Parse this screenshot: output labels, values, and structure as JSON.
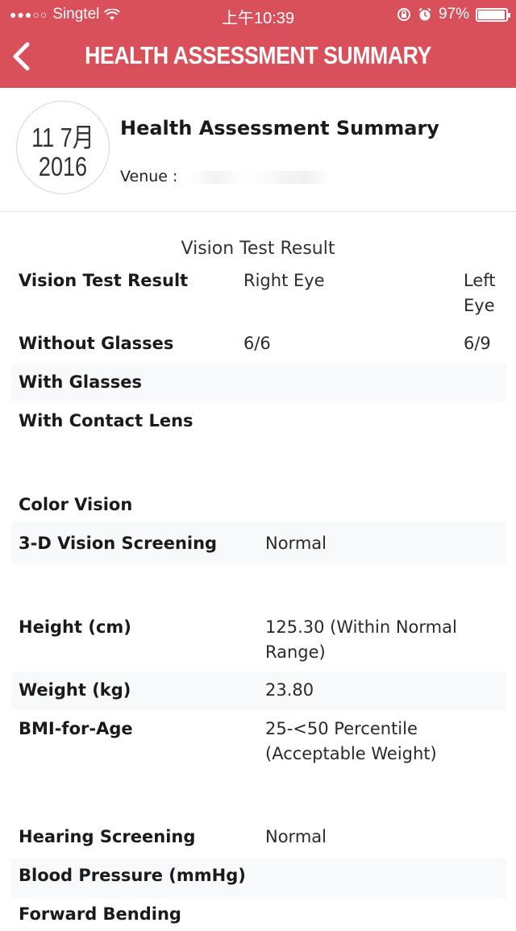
{
  "status_bar": {
    "signal_dots": "●●●○○",
    "carrier": "Singtel",
    "time": "上午10:39",
    "battery_percent": "97%",
    "battery_level": 0.97
  },
  "nav": {
    "title": "HEALTH ASSESSMENT SUMMARY",
    "back_icon": "chevron-left-icon"
  },
  "header": {
    "date_month_day": "11 7月",
    "date_year": "2016",
    "title": "Health Assessment Summary",
    "venue_label": "Venue :"
  },
  "vision": {
    "section_title": "Vision Test Result",
    "header_label": "Vision Test Result",
    "right_eye_label": "Right Eye",
    "left_eye_label": "Left Eye",
    "rows": [
      {
        "label": "Without Glasses",
        "right": "6/6",
        "left": "6/9"
      },
      {
        "label": "With Glasses",
        "right": "",
        "left": ""
      },
      {
        "label": "With Contact Lens",
        "right": "",
        "left": ""
      }
    ]
  },
  "screening": {
    "color_vision_label": "Color Vision",
    "color_vision_value": "",
    "vision3d_label": "3-D Vision Screening",
    "vision3d_value": "Normal"
  },
  "body": {
    "height_label": "Height (cm)",
    "height_value": "125.30 (Within Normal Range)",
    "weight_label": "Weight (kg)",
    "weight_value": "23.80",
    "bmi_label": "BMI-for-Age",
    "bmi_value": "25-<50 Percentile (Acceptable Weight)"
  },
  "other": {
    "hearing_label": "Hearing Screening",
    "hearing_value": "Normal",
    "bp_label": "Blood Pressure (mmHg)",
    "bp_value": "",
    "forward_bending_label": "Forward Bending"
  }
}
